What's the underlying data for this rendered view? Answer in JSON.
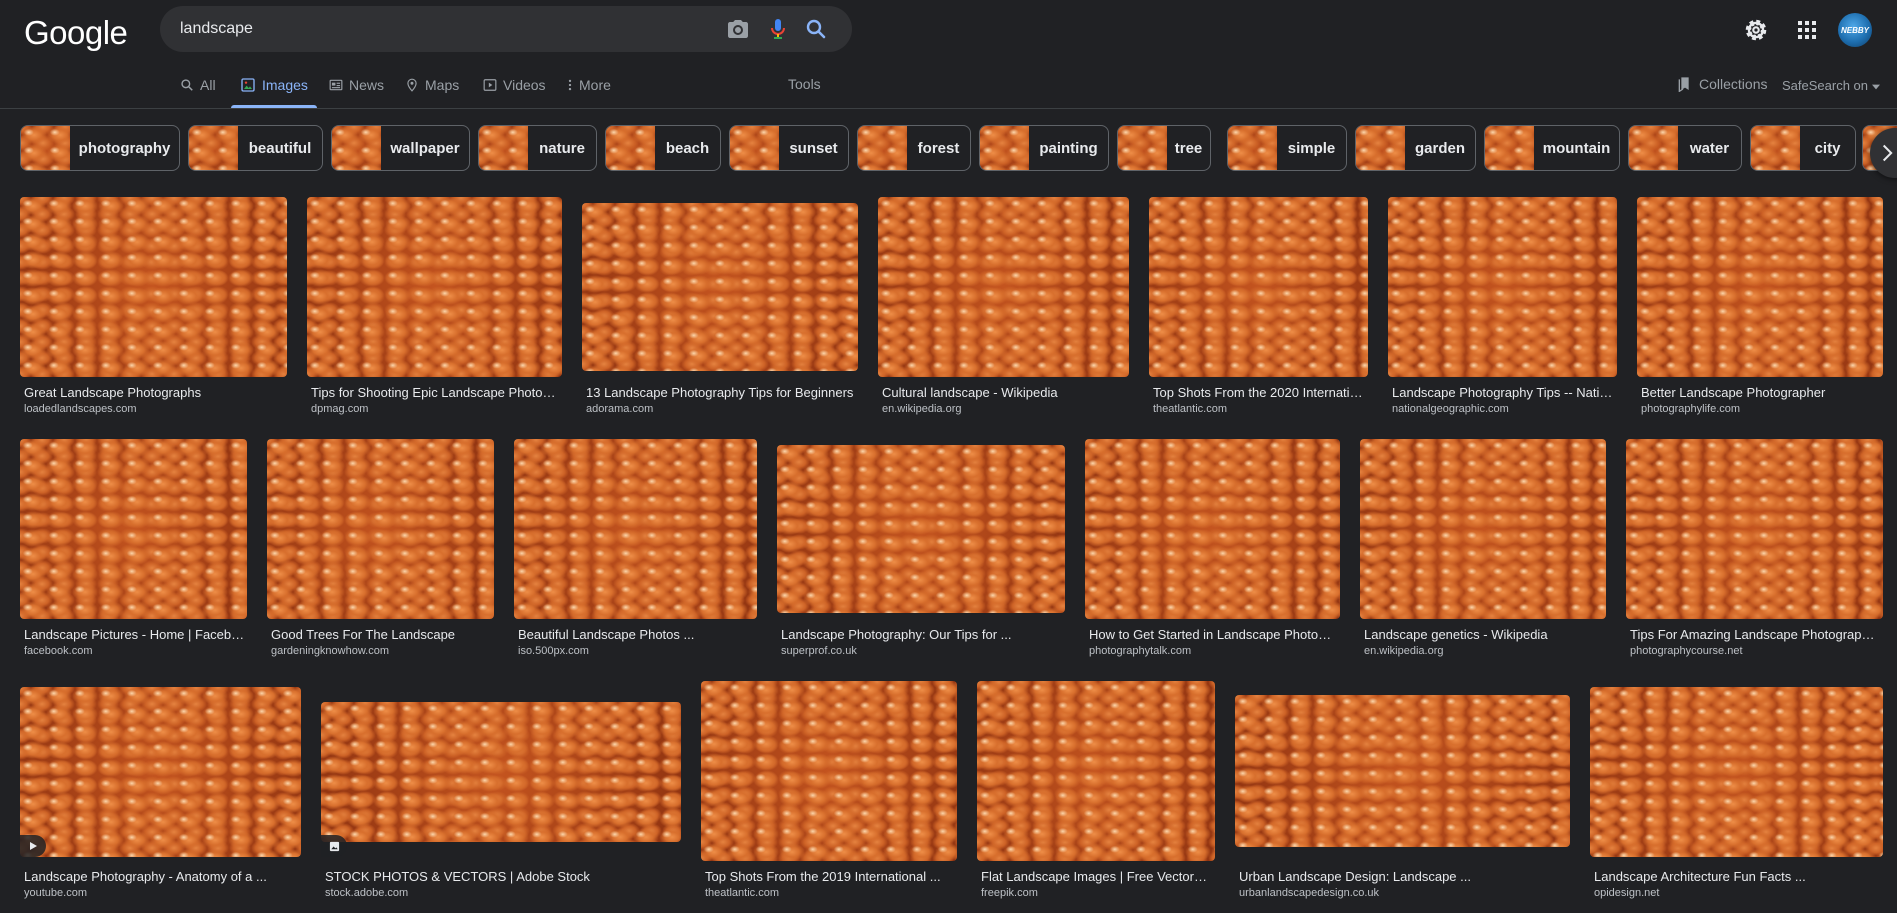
{
  "header": {
    "logo_text": "Google",
    "search_value": "landscape",
    "avatar_text": "NEBBY"
  },
  "tabs": [
    {
      "label": "All",
      "icon": "search-icon"
    },
    {
      "label": "Images",
      "icon": "images-icon",
      "active": true
    },
    {
      "label": "News",
      "icon": "news-icon"
    },
    {
      "label": "Maps",
      "icon": "map-pin-icon"
    },
    {
      "label": "Videos",
      "icon": "video-icon"
    },
    {
      "label": "More",
      "icon": "more-vert-icon"
    }
  ],
  "tools_label": "Tools",
  "collections_label": "Collections",
  "safesearch_label": "SafeSearch on",
  "accent_color": "#8ab4f8",
  "chips": [
    "photography",
    "beautiful",
    "wallpaper",
    "nature",
    "beach",
    "sunset",
    "forest",
    "painting",
    "tree",
    "simple",
    "garden",
    "mountain",
    "water",
    "city"
  ],
  "results": [
    {
      "title": "Great Landscape Photographs",
      "source": "loadedlandscapes.com"
    },
    {
      "title": "Tips for Shooting Epic Landscape Photos ...",
      "source": "dpmag.com"
    },
    {
      "title": "13 Landscape Photography Tips for Beginners",
      "source": "adorama.com"
    },
    {
      "title": "Cultural landscape - Wikipedia",
      "source": "en.wikipedia.org"
    },
    {
      "title": "Top Shots From the 2020 International ...",
      "source": "theatlantic.com"
    },
    {
      "title": "Landscape Photography Tips -- National ...",
      "source": "nationalgeographic.com"
    },
    {
      "title": "Better Landscape Photographer",
      "source": "photographylife.com"
    },
    {
      "title": "Landscape Pictures - Home | Facebook",
      "source": "facebook.com"
    },
    {
      "title": "Good Trees For The Landscape",
      "source": "gardeningknowhow.com"
    },
    {
      "title": "Beautiful Landscape Photos ...",
      "source": "iso.500px.com"
    },
    {
      "title": "Landscape Photography: Our Tips for ...",
      "source": "superprof.co.uk"
    },
    {
      "title": "How to Get Started in Landscape Photography",
      "source": "photographytalk.com"
    },
    {
      "title": "Landscape genetics - Wikipedia",
      "source": "en.wikipedia.org"
    },
    {
      "title": "Tips For Amazing Landscape Photography ...",
      "source": "photographycourse.net"
    },
    {
      "title": "Landscape Photography - Anatomy of a ...",
      "source": "youtube.com",
      "badge": "play-icon"
    },
    {
      "title": "STOCK PHOTOS & VECTORS | Adobe Stock",
      "source": "stock.adobe.com",
      "badge": "image-icon"
    },
    {
      "title": "Top Shots From the 2019 International ...",
      "source": "theatlantic.com"
    },
    {
      "title": "Flat Landscape Images | Free Vectors ...",
      "source": "freepik.com"
    },
    {
      "title": "Urban Landscape Design: Landscape ...",
      "source": "urbanlandscapedesign.co.uk"
    },
    {
      "title": "Landscape Architecture Fun Facts ...",
      "source": "opidesign.net"
    }
  ]
}
